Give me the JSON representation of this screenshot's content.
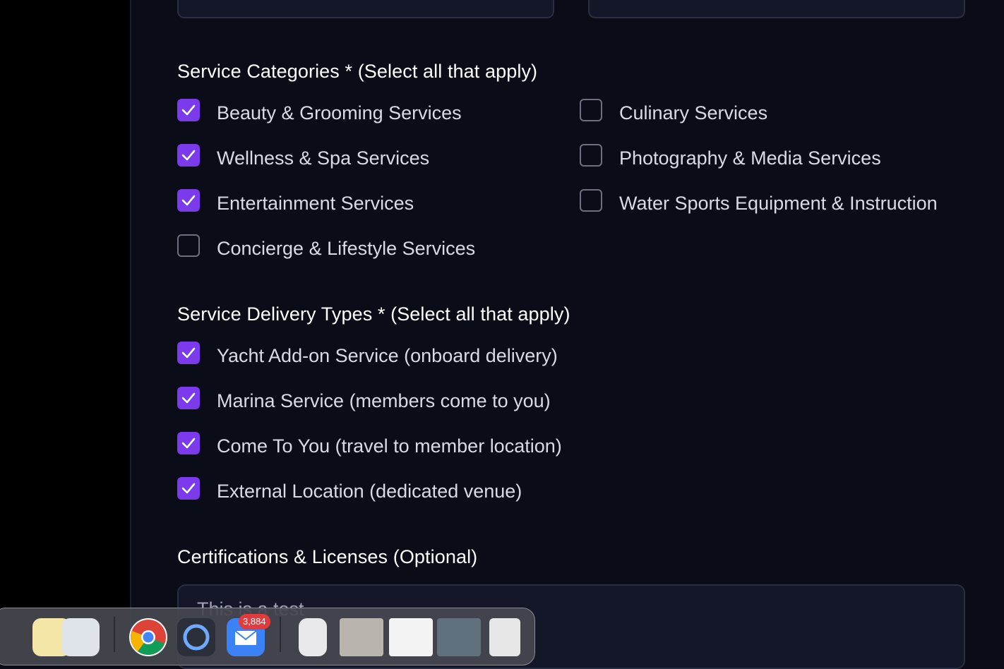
{
  "categories": {
    "title": "Service Categories * (Select all that apply)",
    "options": [
      {
        "label": "Beauty & Grooming Services",
        "checked": true
      },
      {
        "label": "Culinary Services",
        "checked": false
      },
      {
        "label": "Wellness & Spa Services",
        "checked": true
      },
      {
        "label": "Photography & Media Services",
        "checked": false
      },
      {
        "label": "Entertainment Services",
        "checked": true
      },
      {
        "label": "Water Sports Equipment & Instruction",
        "checked": false
      },
      {
        "label": "Concierge & Lifestyle Services",
        "checked": false
      }
    ]
  },
  "delivery": {
    "title": "Service Delivery Types * (Select all that apply)",
    "options": [
      {
        "label": "Yacht Add-on Service (onboard delivery)",
        "checked": true
      },
      {
        "label": "Marina Service (members come to you)",
        "checked": true
      },
      {
        "label": "Come To You (travel to member location)",
        "checked": true
      },
      {
        "label": "External Location (dedicated venue)",
        "checked": true
      }
    ]
  },
  "certifications": {
    "title": "Certifications & Licenses (Optional)",
    "value": "This is a test"
  },
  "dock": {
    "mail_badge": "3,884"
  },
  "colors": {
    "accent": "#7c3aed",
    "background": "#0a0d18"
  }
}
